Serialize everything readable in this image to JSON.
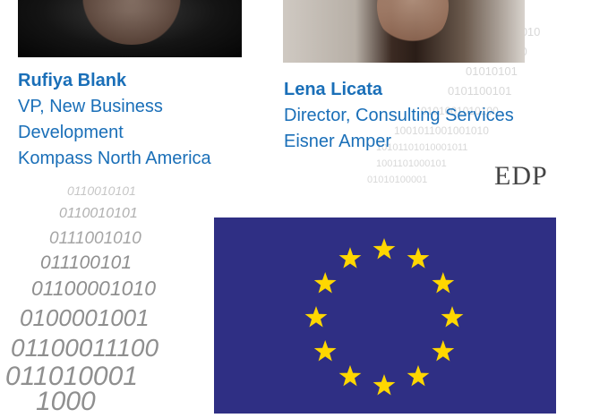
{
  "people": [
    {
      "name": "Rufiya Blank",
      "title_line1": "VP, New Business",
      "title_line2": "Development",
      "company": "Kompass North America"
    },
    {
      "name": "Lena Licata",
      "title_line1": "Director, Consulting Services",
      "company": "Eisner Amper"
    }
  ],
  "brand_text": "EDP",
  "colors": {
    "name_text": "#1a6fb8",
    "eu_blue": "#2f2f84",
    "eu_star": "#ffd700",
    "binary_gray": "#9a9a9a"
  }
}
